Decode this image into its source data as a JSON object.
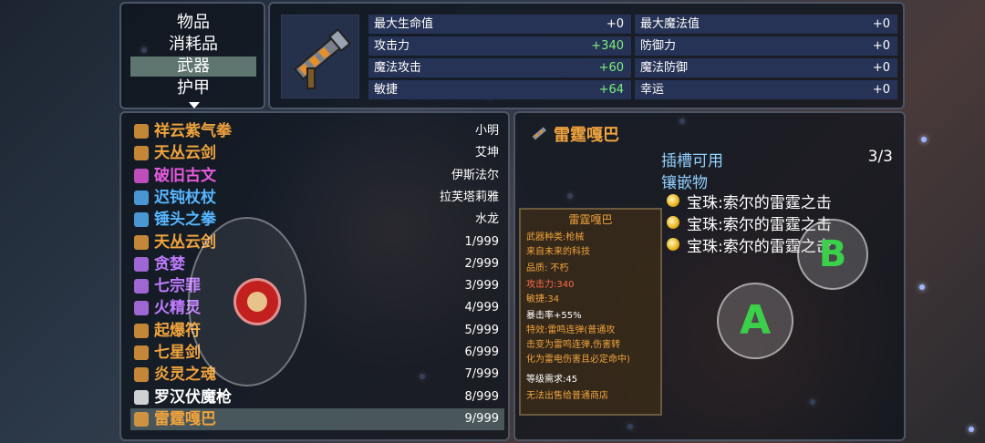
{
  "menu": {
    "categories": [
      "物品",
      "消耗品",
      "武器",
      "护甲"
    ],
    "selected_index": 2
  },
  "stats": {
    "left": [
      {
        "label": "最大生命值",
        "value": "+0"
      },
      {
        "label": "攻击力",
        "value": "+340"
      },
      {
        "label": "魔法攻击",
        "value": "+60"
      },
      {
        "label": "敏捷",
        "value": "+64"
      }
    ],
    "right": [
      {
        "label": "最大魔法值",
        "value": "+0"
      },
      {
        "label": "防御力",
        "value": "+0"
      },
      {
        "label": "魔法防御",
        "value": "+0"
      },
      {
        "label": "幸运",
        "value": "+0"
      }
    ]
  },
  "items": [
    {
      "name": "祥云紫气拳",
      "count": "小明",
      "color": "#f0a33c",
      "icon": "fist-icon"
    },
    {
      "name": "天丛云剑",
      "count": "艾坤",
      "color": "#f0a33c",
      "icon": "sword-icon"
    },
    {
      "name": "破旧古文",
      "count": "伊斯法尔",
      "color": "#e85be0",
      "icon": "scroll-icon"
    },
    {
      "name": "迟钝杖杖",
      "count": "拉芙塔莉雅",
      "color": "#56b6ff",
      "icon": "staff-icon"
    },
    {
      "name": "锤头之拳",
      "count": "水龙",
      "color": "#56b6ff",
      "icon": "knuckle-icon"
    },
    {
      "name": "天丛云剑",
      "count": "1/999",
      "color": "#f0a33c",
      "icon": "sword-icon"
    },
    {
      "name": "贪婪",
      "count": "2/999",
      "color": "#c07bff",
      "icon": "spear-icon"
    },
    {
      "name": "七宗罪",
      "count": "3/999",
      "color": "#c07bff",
      "icon": "book-icon"
    },
    {
      "name": "火精灵",
      "count": "4/999",
      "color": "#c07bff",
      "icon": "fire-staff-icon"
    },
    {
      "name": "起爆符",
      "count": "5/999",
      "color": "#f0a33c",
      "icon": "talisman-icon"
    },
    {
      "name": "七星剑",
      "count": "6/999",
      "color": "#f0a33c",
      "icon": "sword-icon"
    },
    {
      "name": "炎灵之魂",
      "count": "7/999",
      "color": "#f0a33c",
      "icon": "flame-icon"
    },
    {
      "name": "罗汉伏魔枪",
      "count": "8/999",
      "color": "#ffffff",
      "icon": "spear-icon"
    },
    {
      "name": "雷霆嘎巴",
      "count": "9/999",
      "color": "#f0a33c",
      "icon": "cannon-icon"
    }
  ],
  "selected_item_index": 13,
  "detail": {
    "title": "雷霆嘎巴",
    "slots_label": "插槽可用",
    "slots_value": "3/3",
    "inlay_label": "镶嵌物",
    "gems": [
      "宝珠:索尔的雷霆之击",
      "宝珠:索尔的雷霆之击",
      "宝珠:索尔的雷霆之击"
    ]
  },
  "tooltip": {
    "title": "雷霆嘎巴",
    "type": "武器种类:枪械",
    "desc": "来自未来的科技",
    "quality": "品质: 不朽",
    "attack": "攻击力:340",
    "agility": "敏捷:34",
    "crit": "暴击率+55%",
    "effect1": "特效:雷鸣连弹(普通攻",
    "effect2": "击变为雷鸣连弹,伤害转",
    "effect3": "化为雷电伤害且必定命中)",
    "level": "等级需求:45",
    "shop": "无法出售给普通商店"
  },
  "buttons": {
    "a": "A",
    "b": "B"
  }
}
